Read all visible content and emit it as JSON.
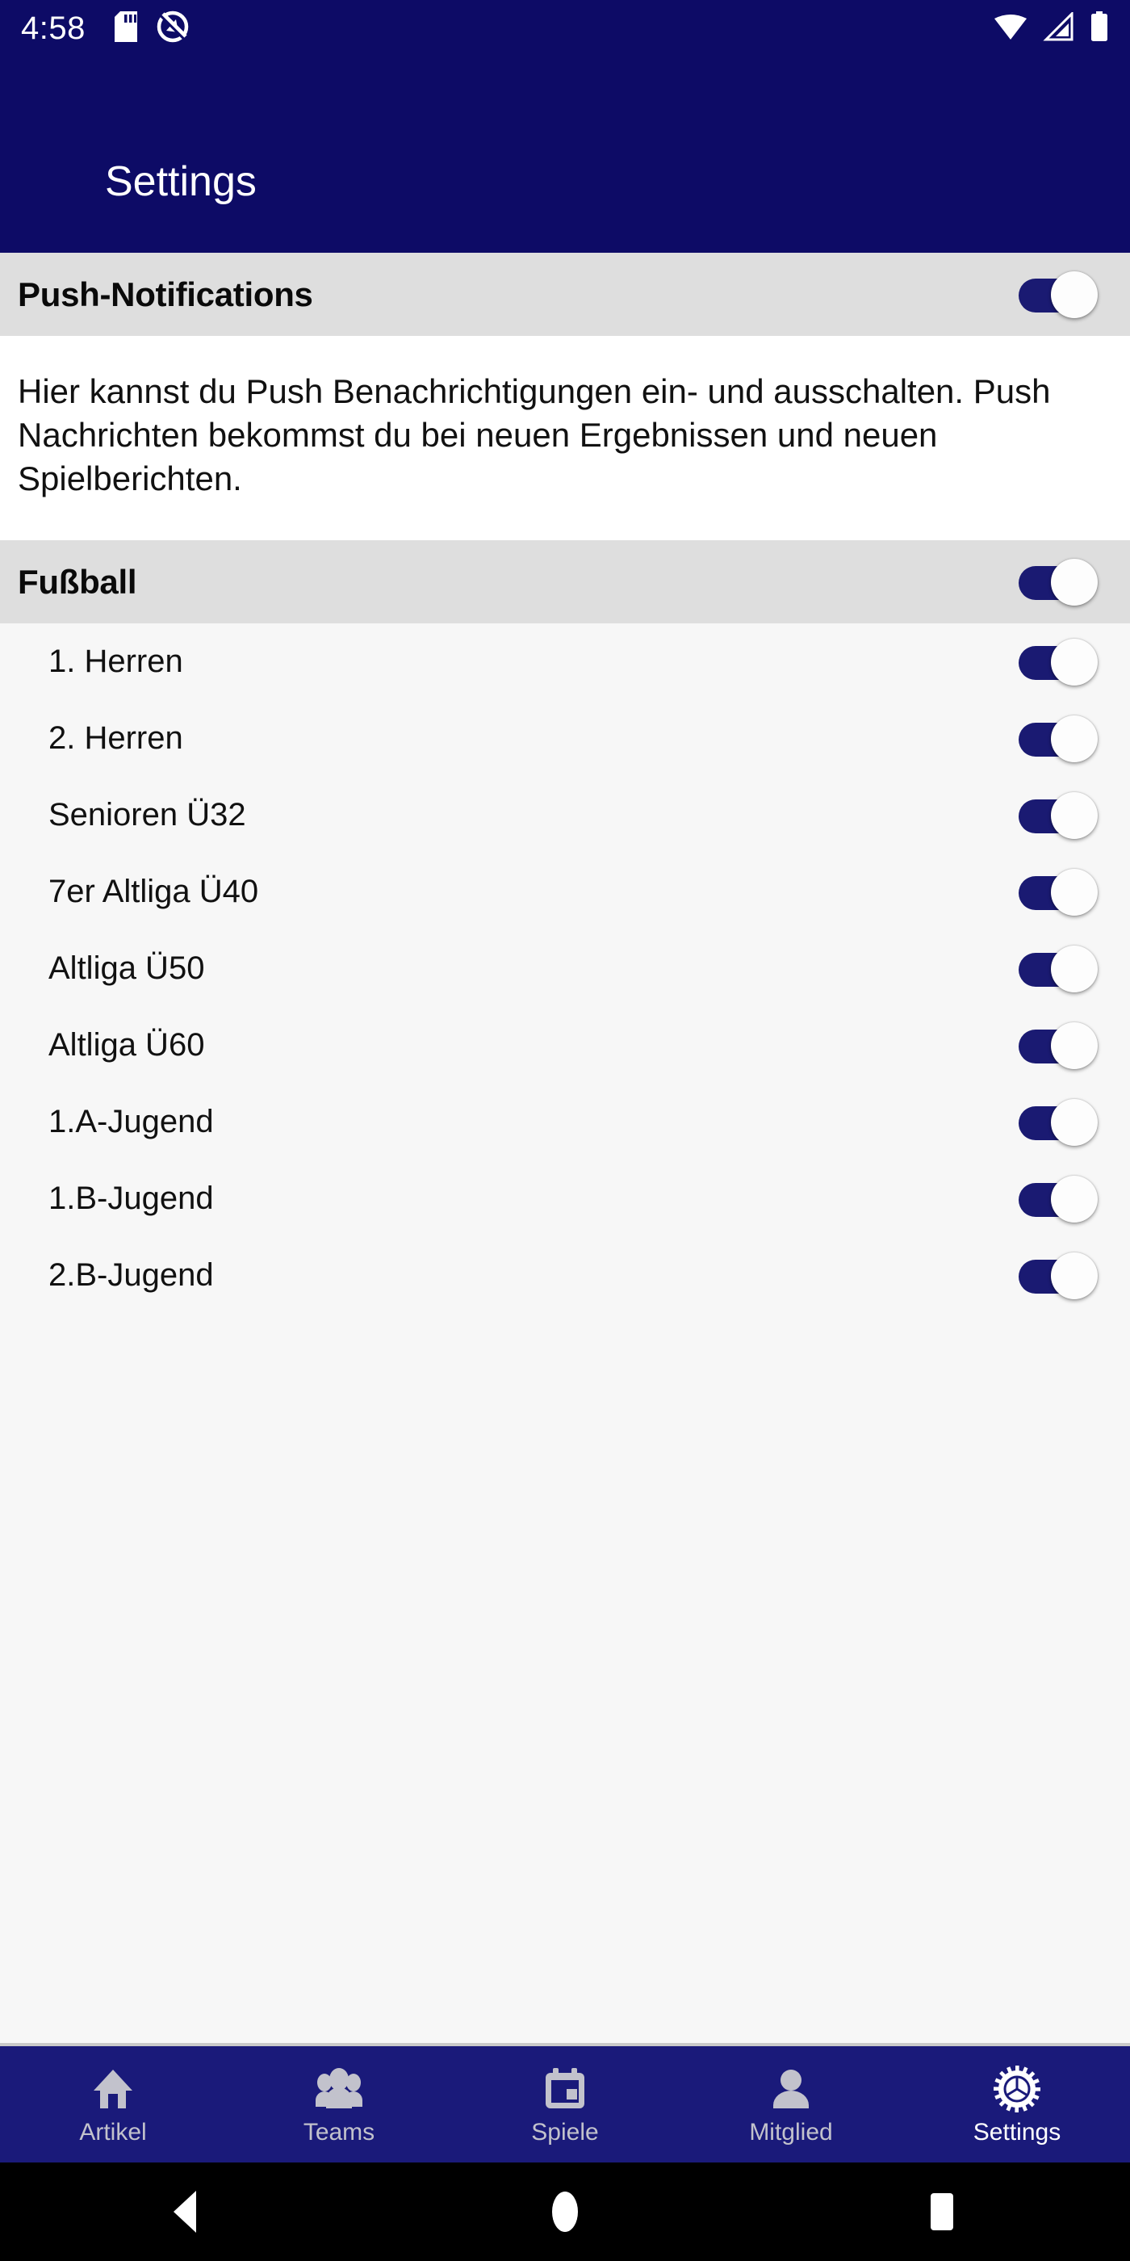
{
  "status_bar": {
    "time": "4:58",
    "left_icons": [
      "sd-card-icon",
      "do-not-disturb-icon"
    ],
    "right_icons": [
      "wifi-icon",
      "cellular-signal-icon",
      "battery-icon"
    ]
  },
  "app_bar": {
    "title": "Settings",
    "background_color": "#0d0b66"
  },
  "push_section": {
    "title": "Push-Notifications",
    "toggle_on": true,
    "description": "Hier kannst du Push Benachrichtigungen ein- und ausschalten. Push Nachrichten bekommst du bei neuen Ergebnissen und neuen Spielberichten."
  },
  "sport_section": {
    "title": "Fußball",
    "toggle_on": true
  },
  "teams": [
    {
      "label": "1. Herren",
      "toggle_on": true
    },
    {
      "label": "2. Herren",
      "toggle_on": true
    },
    {
      "label": "Senioren Ü32",
      "toggle_on": true
    },
    {
      "label": "7er Altliga Ü40",
      "toggle_on": true
    },
    {
      "label": "Altliga Ü50",
      "toggle_on": true
    },
    {
      "label": "Altliga Ü60",
      "toggle_on": true
    },
    {
      "label": "1.A-Jugend",
      "toggle_on": true
    },
    {
      "label": "1.B-Jugend",
      "toggle_on": true
    },
    {
      "label": "2.B-Jugend",
      "toggle_on": true
    }
  ],
  "bottom_nav": {
    "items": [
      {
        "label": "Artikel",
        "icon": "home-icon",
        "active": false
      },
      {
        "label": "Teams",
        "icon": "people-icon",
        "active": false
      },
      {
        "label": "Spiele",
        "icon": "calendar-icon",
        "active": false
      },
      {
        "label": "Mitglied",
        "icon": "person-icon",
        "active": false
      },
      {
        "label": "Settings",
        "icon": "gear-icon",
        "active": true
      }
    ],
    "background_color": "#1a1a7a",
    "inactive_color": "#c2c2cc",
    "active_color": "#ffffff"
  },
  "system_nav": {
    "buttons": [
      "back-button",
      "home-button",
      "recents-button"
    ],
    "background_color": "#000000"
  },
  "colors": {
    "primary_navy": "#0d0b66",
    "toggle_track": "#1a1a72",
    "section_header_bg": "#dedede",
    "list_bg": "#f7f7f7",
    "description_bg": "#ffffff"
  }
}
